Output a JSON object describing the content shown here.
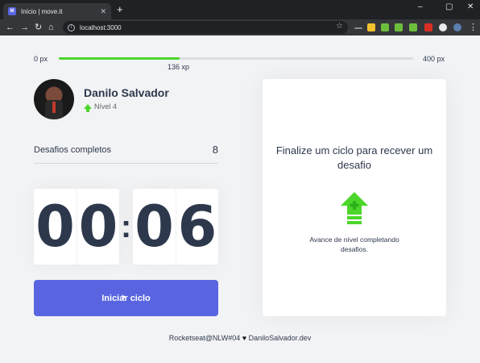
{
  "browser": {
    "tab_title": "Início | move.it",
    "favicon_text": "M",
    "close_glyph": "✕",
    "new_tab_glyph": "+",
    "url": "localhost:3000",
    "window_controls": [
      "–",
      "▢",
      "✕"
    ],
    "nav_icons": [
      "arrow-left-icon",
      "arrow-right-icon",
      "reload-icon",
      "home-icon"
    ],
    "extension_colors": [
      "#8a8a8a",
      "#f2c12e",
      "#6cbf3c",
      "#6cbf3c",
      "#d93025",
      "#e8eaed",
      "#5a7fb0"
    ]
  },
  "xp": {
    "min_label": "0 px",
    "max_label": "400 px",
    "current_label": "136 xp",
    "progress_percent": 34,
    "fill_color": "#4cd62b"
  },
  "profile": {
    "name": "Danilo Salvador",
    "level": "Nível 4"
  },
  "completed": {
    "label": "Desafios completos",
    "value": "8"
  },
  "countdown": {
    "minute_left": "0",
    "minute_right": "0",
    "colon": ":",
    "second_left": "0",
    "second_right": "6"
  },
  "start_button": {
    "label": "Iniciar ciclo",
    "color": "#5965e0"
  },
  "challenge": {
    "title": "Finalize um ciclo para recever um desafio",
    "icon": "level-up-icon",
    "text": "Avance de nível completando desafios."
  },
  "footer": {
    "left": "Rocketseat@NLW#04",
    "heart": "♥",
    "right": "DaniloSalvador.dev"
  }
}
